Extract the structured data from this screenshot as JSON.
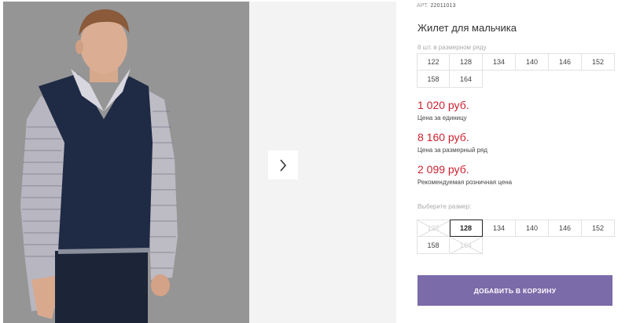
{
  "product": {
    "sku_label": "АРТ.",
    "sku_value": "22011013",
    "title": "Жилет для мальчика"
  },
  "gallery": {
    "next_icon": "chevron-right-icon",
    "main_photo": "boy-in-navy-vest-photo"
  },
  "size_pack": {
    "label": "8 шт. в размерном ряду",
    "sizes": [
      "122",
      "128",
      "134",
      "140",
      "146",
      "152",
      "158",
      "164"
    ]
  },
  "prices": {
    "unit_price": "1 020 руб.",
    "unit_note": "Цена за единицу",
    "pack_price": "8 160 руб.",
    "pack_note": "Цена за размерный ряд",
    "retail_price": "2 099 руб.",
    "retail_note": "Рекомендуемая розничная цена",
    "price_color": "#cc2130"
  },
  "size_select": {
    "label": "Выберите размер:",
    "options": [
      {
        "size": "122",
        "state": "disabled"
      },
      {
        "size": "128",
        "state": "selected"
      },
      {
        "size": "134",
        "state": "available"
      },
      {
        "size": "140",
        "state": "available"
      },
      {
        "size": "146",
        "state": "available"
      },
      {
        "size": "152",
        "state": "available"
      },
      {
        "size": "158",
        "state": "available"
      },
      {
        "size": "164",
        "state": "disabled"
      }
    ]
  },
  "cart": {
    "button_label": "ДОБАВИТЬ В КОРЗИНУ",
    "button_color": "#7b6ba9"
  }
}
